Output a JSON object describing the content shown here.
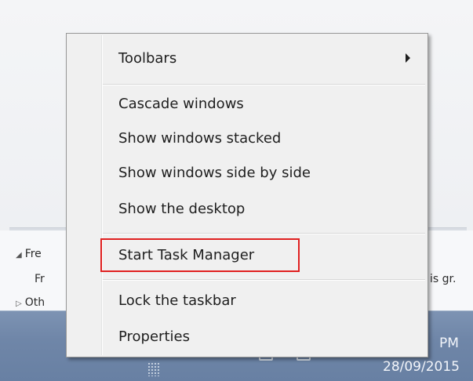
{
  "background": {
    "group1": "Fre",
    "group1_sub": "Fr",
    "group2": "Oth",
    "right_text": "is gr."
  },
  "context_menu": {
    "items": [
      {
        "label": "Toolbars",
        "has_submenu": true
      },
      {
        "label": "Cascade windows"
      },
      {
        "label": "Show windows stacked"
      },
      {
        "label": "Show windows side by side"
      },
      {
        "label": "Show the desktop"
      },
      {
        "label": "Start Task Manager",
        "highlighted": true
      },
      {
        "label": "Lock the taskbar"
      },
      {
        "label": "Properties"
      }
    ],
    "highlight_color": "#e02020"
  },
  "taskbar": {
    "time": "PM",
    "date": "28/09/2015"
  },
  "icons": [
    "collapse-triangle-icon",
    "expand-triangle-icon",
    "submenu-arrow-icon",
    "taskbar-grip-icon",
    "tray-icon"
  ]
}
